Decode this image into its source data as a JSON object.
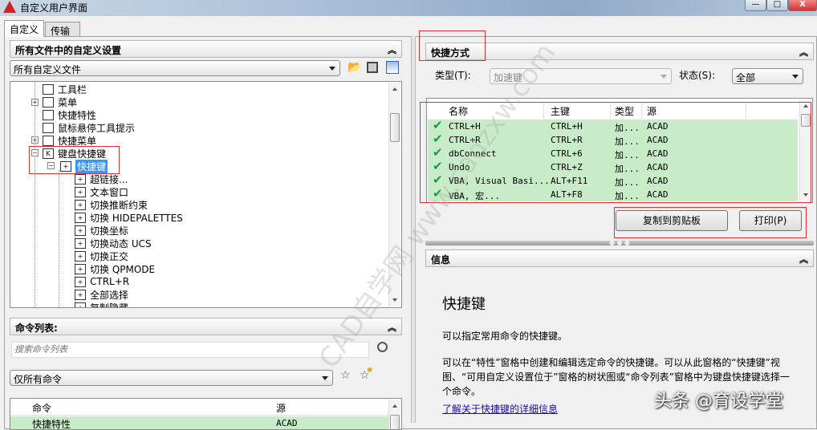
{
  "window": {
    "title": "自定义用户界面",
    "minimize": "—",
    "maximize": "□",
    "close": "X"
  },
  "tabs": [
    {
      "label": "自定义"
    },
    {
      "label": "传输"
    }
  ],
  "customizations": {
    "header": "所有文件中的自定义设置",
    "file_dropdown": "所有自定义文件",
    "tree": [
      {
        "label": "工具栏",
        "expander": "+"
      },
      {
        "label": "菜单",
        "expander": "+"
      },
      {
        "label": "快捷特性"
      },
      {
        "label": "鼠标悬停工具提示"
      },
      {
        "label": "快捷菜单",
        "expander": "+"
      },
      {
        "label": "键盘快捷键",
        "expander": "−"
      },
      {
        "label": "快捷键",
        "expander": "−"
      },
      {
        "label": "超链接..."
      },
      {
        "label": "文本窗口"
      },
      {
        "label": "切换推断约束"
      },
      {
        "label": "切换 HIDEPALETTES"
      },
      {
        "label": "切换坐标"
      },
      {
        "label": "切换动态 UCS"
      },
      {
        "label": "切换正交"
      },
      {
        "label": "切换 QPMODE"
      },
      {
        "label": "CTRL+R"
      },
      {
        "label": "全部选择"
      },
      {
        "label": "复制隐藏"
      }
    ]
  },
  "command_list": {
    "header": "命令列表:",
    "search_placeholder": "搜索命令列表",
    "filter": "仅所有命令",
    "columns": [
      "命令",
      "源"
    ],
    "rows": [
      {
        "command": "快捷特性",
        "source": "ACAD"
      }
    ]
  },
  "shortcuts": {
    "header": "快捷方式",
    "type_label": "类型(T):",
    "type_value": "加速键",
    "status_label": "状态(S):",
    "status_value": "全部",
    "columns": [
      "名称",
      "主键",
      "类型",
      "源"
    ],
    "rows": [
      {
        "name": "CTRL+H",
        "key": "CTRL+H",
        "type": "加...",
        "source": "ACAD"
      },
      {
        "name": "CTRL+R",
        "key": "CTRL+R",
        "type": "加...",
        "source": "ACAD"
      },
      {
        "name": "dbConnect",
        "key": "CTRL+6",
        "type": "加...",
        "source": "ACAD"
      },
      {
        "name": "Undo",
        "key": "CTRL+Z",
        "type": "加...",
        "source": "ACAD"
      },
      {
        "name": "VBA, Visual Basi...",
        "key": "ALT+F11",
        "type": "加...",
        "source": "ACAD"
      },
      {
        "name": "VBA, 宏...",
        "key": "ALT+F8",
        "type": "加...",
        "source": "ACAD"
      }
    ],
    "copy_button": "复制到剪贴板",
    "print_button": "打印(P)"
  },
  "info": {
    "header": "信息",
    "title": "快捷键",
    "line1": "可以指定常用命令的快捷键。",
    "para": "可以在“特性”窗格中创建和编辑选定命令的快捷键。可以从此窗格的“快捷键”视图、“可用自定义设置位于”窗格的树状图或“命令列表”窗格中为键盘快捷键选择一个命令。",
    "link": "了解关于快捷键的详细信息"
  },
  "watermarks": {
    "site": "CAD自学网 www.cadzxw.com",
    "author": "头条 @育设学堂"
  },
  "colors": {
    "selection": "#3399ff",
    "row_green": "#c8ecc8",
    "highlight_red": "#e03030",
    "link": "#1a0dab"
  }
}
